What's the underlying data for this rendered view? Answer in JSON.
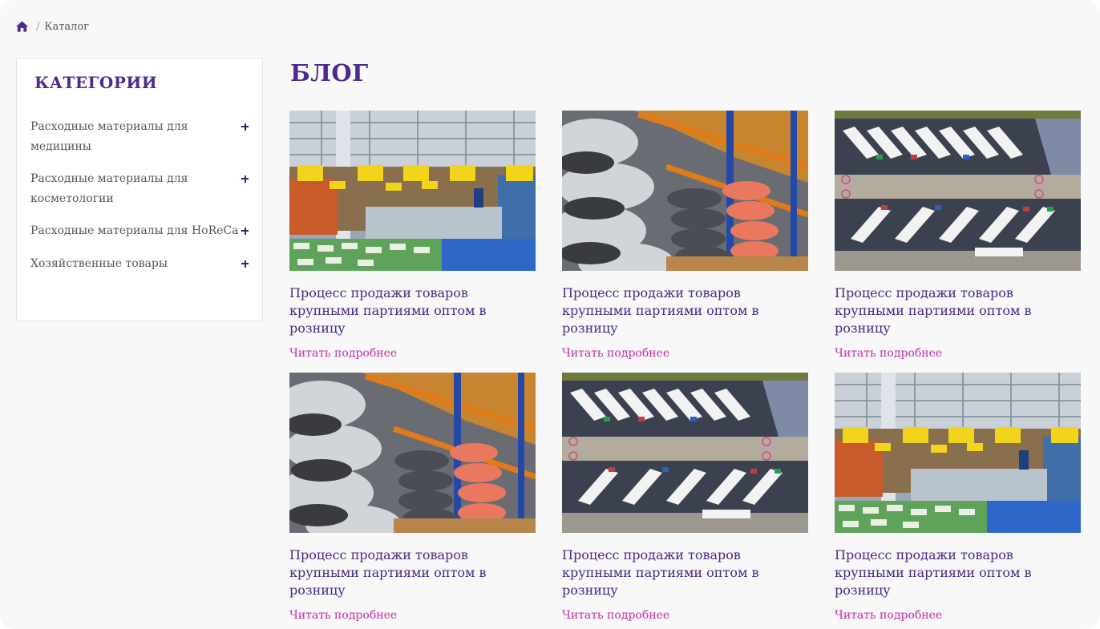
{
  "breadcrumb": {
    "home_icon": "home-icon",
    "separator": "/",
    "current": "Каталог"
  },
  "sidebar": {
    "title": "КАТЕГОРИИ",
    "categories": [
      {
        "label": "Расходные материалы для медицины",
        "toggle_icon": "plus-icon"
      },
      {
        "label": "Расходные материалы для косметологии",
        "toggle_icon": "plus-icon"
      },
      {
        "label": "Расходные материалы для HoReCa",
        "toggle_icon": "plus-icon"
      },
      {
        "label": "Хозяйственные товары",
        "toggle_icon": "plus-icon"
      }
    ]
  },
  "main": {
    "title": "БЛОГ",
    "posts": [
      {
        "image": "warehouse-interior-photo",
        "title": "Процесс продажи товаров крупными партиями оптом в розницу",
        "link": "Читать подробнее"
      },
      {
        "image": "fabric-rolls-photo",
        "title": "Процесс продажи товаров крупными партиями оптом в розницу",
        "link": "Читать подробнее"
      },
      {
        "image": "truck-parking-aerial-photo",
        "title": "Процесс продажи товаров крупными партиями оптом в розницу",
        "link": "Читать подробнее"
      },
      {
        "image": "fabric-rolls-photo",
        "title": "Процесс продажи товаров крупными партиями оптом в розницу",
        "link": "Читать подробнее"
      },
      {
        "image": "truck-parking-aerial-photo",
        "title": "Процесс продажи товаров крупными партиями оптом в розницу",
        "link": "Читать подробнее"
      },
      {
        "image": "warehouse-interior-photo",
        "title": "Процесс продажи товаров крупными партиями оптом в розницу",
        "link": "Читать подробнее"
      }
    ]
  },
  "colors": {
    "accent": "#4e2a8e",
    "link": "#c12fa6",
    "background": "#f8f8f9"
  }
}
